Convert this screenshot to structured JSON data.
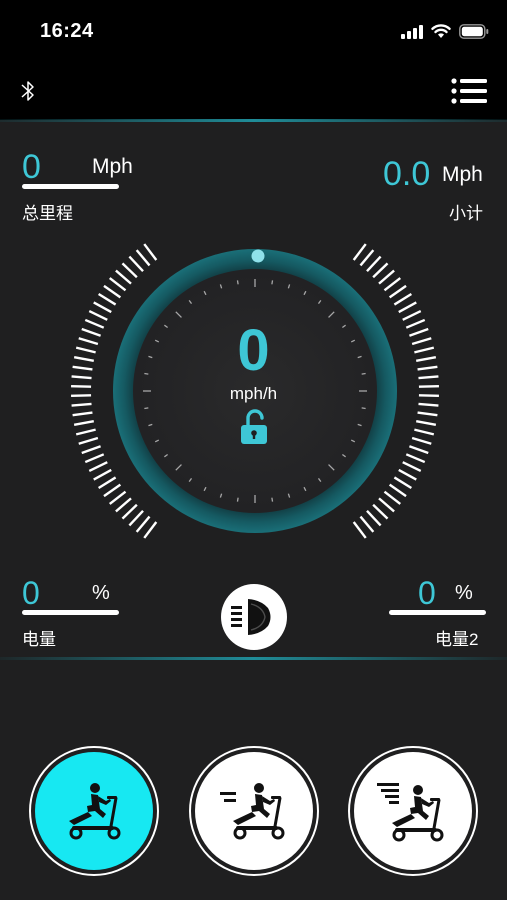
{
  "status_bar": {
    "time": "16:24",
    "icons": [
      "cellular-signal-icon",
      "wifi-icon",
      "battery-icon"
    ]
  },
  "nav": {
    "left_icon": "bluetooth-icon",
    "right_icon": "list-menu-icon"
  },
  "stats": {
    "total_mileage": {
      "value": "0",
      "unit": "Mph",
      "label": "总里程"
    },
    "trip": {
      "value": "0.0",
      "unit": "Mph",
      "label": "小计"
    },
    "battery1": {
      "value": "0",
      "unit": "%",
      "label": "电量"
    },
    "battery2": {
      "value": "0",
      "unit": "%",
      "label": "电量2"
    }
  },
  "speedometer": {
    "value": "0",
    "unit": "mph/h",
    "lock_icon": "unlocked-padlock-icon"
  },
  "headlight": {
    "icon": "headlight-icon"
  },
  "modes": [
    {
      "name": "mode-1",
      "icon": "scooter-rider-icon",
      "active": true
    },
    {
      "name": "mode-2",
      "icon": "scooter-rider-fast-icon",
      "active": false
    },
    {
      "name": "mode-3",
      "icon": "scooter-rider-fastest-icon",
      "active": false
    }
  ],
  "colors": {
    "accent": "#3ec7d6",
    "active_mode": "#17e8f2",
    "background": "#1f1f20",
    "bar": "#000000"
  }
}
